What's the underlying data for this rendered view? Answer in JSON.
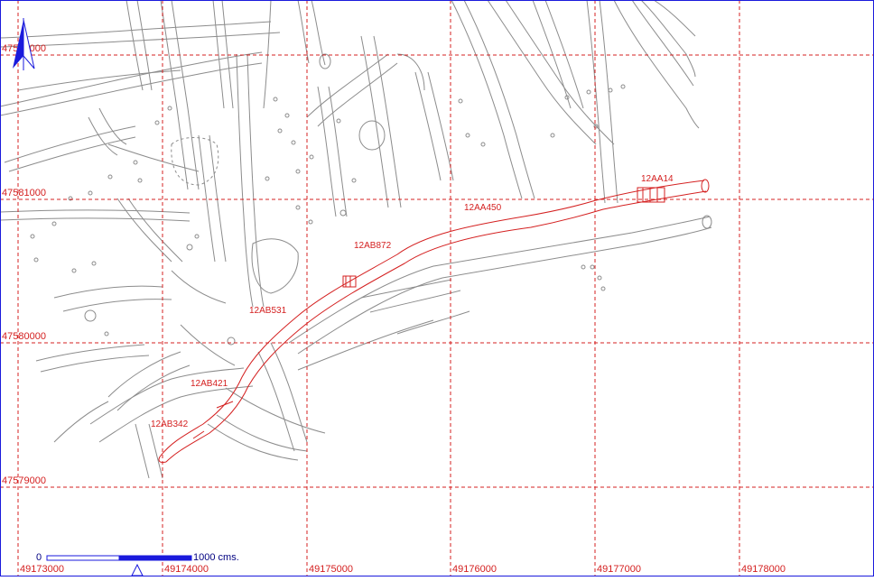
{
  "map": {
    "grid_color": "#d42020",
    "passage_color": "#8c8c8c",
    "highlight_color": "#d42020",
    "frame_color": "#1a1adc",
    "x_labels": [
      "49173000",
      "49174000",
      "49175000",
      "49176000",
      "49177000",
      "49178000"
    ],
    "y_labels": [
      "47581000",
      "47580000",
      "47579000"
    ],
    "top_label": "47582000",
    "station_labels": [
      "12AA14",
      "12AA450",
      "12AB872",
      "12AB531",
      "12AB421",
      "12AB342"
    ],
    "north_arrow": "north-arrow-icon",
    "scale_bar": {
      "start_label": "0",
      "end_label": "1000 cms."
    }
  }
}
